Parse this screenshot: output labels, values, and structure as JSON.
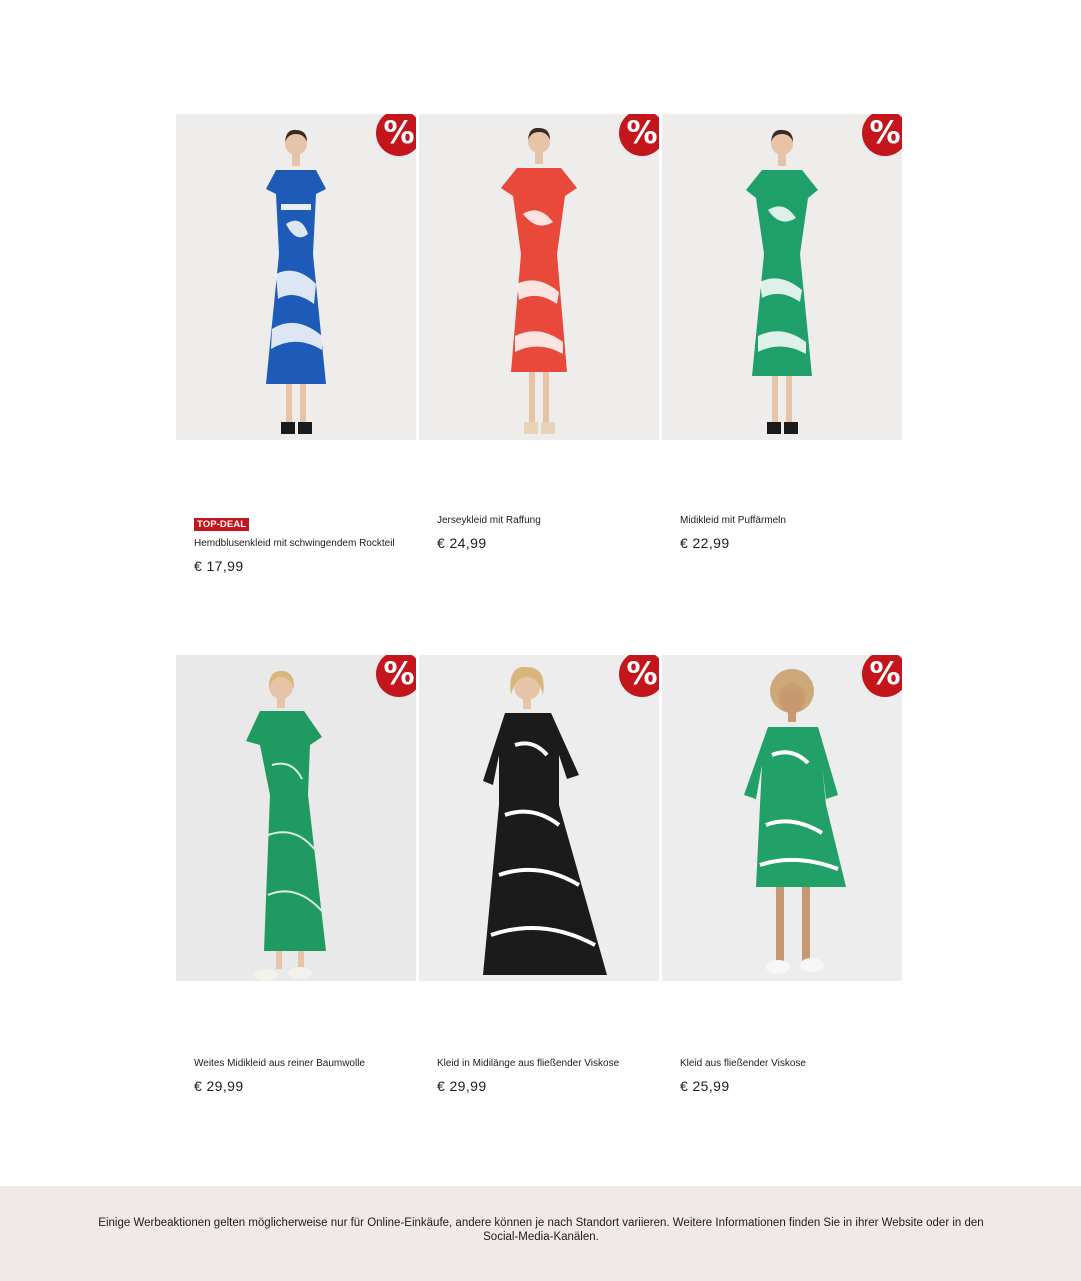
{
  "promo_badge_symbol": "%",
  "products": [
    {
      "tag": "TOP-DEAL",
      "name": "Hemdblusenkleid mit schwingendem Rockteil",
      "price": "€ 17,99",
      "dress_color": "#1e5bb8",
      "background": "#efecec"
    },
    {
      "tag": "",
      "name": "Jerseykleid mit Raffung",
      "price": "€ 24,99",
      "dress_color": "#e8493a",
      "background": "#efecec"
    },
    {
      "tag": "",
      "name": "Midikleid mit Puffärmeln",
      "price": "€ 22,99",
      "dress_color": "#1fa06b",
      "background": "#efecec"
    },
    {
      "tag": "",
      "name": "Weites Midikleid aus reiner Baumwolle",
      "price": "€ 29,99",
      "dress_color": "#1f9a60",
      "background": "#e9e9ea"
    },
    {
      "tag": "",
      "name": "Kleid in Midilänge aus fließender Viskose",
      "price": "€ 29,99",
      "dress_color": "#1b1b1b",
      "background": "#ededee"
    },
    {
      "tag": "",
      "name": "Kleid aus fließender Viskose",
      "price": "€ 25,99",
      "dress_color": "#21a067",
      "background": "#ededee"
    }
  ],
  "colors": {
    "accent": "#c4151c",
    "footer_bg": "#f1e9e7"
  },
  "footer": {
    "disclaimer": "Einige Werbeaktionen gelten möglicherweise nur für Online-Einkäufe, andere können je nach Standort variieren. Weitere Informationen finden Sie in ihrer Website oder in den Social-Media-Kanälen."
  }
}
